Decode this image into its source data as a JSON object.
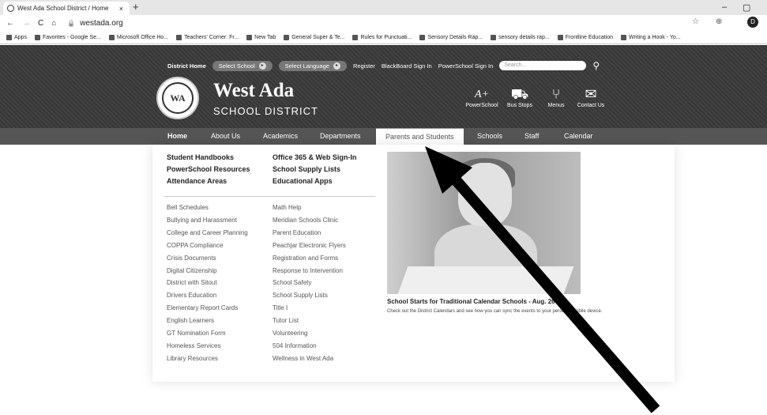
{
  "browser": {
    "tab_title": "West Ada School District / Home",
    "tab_close": "×",
    "new_tab": "+",
    "window_minimize": "–",
    "window_restore": "▢",
    "back": "←",
    "forward": "→",
    "reload": "C",
    "home": "⌂",
    "lock": "🔒",
    "url": "westada.org",
    "star_text": "☆",
    "extension_text": "⊕",
    "profile_initial": "D",
    "bookmarks": [
      "Apps",
      "Favorites - Google Se...",
      "Microsoft Office Ho...",
      "Teachers' Corner: Fr...",
      "New Tab",
      "General Super & Te...",
      "Rules for Punctuati...",
      "Sensory Details Rap...",
      "sensory details rap...",
      "Frontline Education",
      "Writing a Hook - Yo..."
    ]
  },
  "site": {
    "topnav": {
      "district_home": "District Home",
      "select_school": "Select School",
      "select_language": "Select Language",
      "register": "Register",
      "blackboard": "BlackBoard Sign In",
      "powerschool_sign_in": "PowerSchool Sign In",
      "search_placeholder": "Search..."
    },
    "logo": {
      "initials": "WA",
      "title": "West Ada",
      "subtitle": "SCHOOL DISTRICT"
    },
    "quick_links": [
      {
        "icon": "powerschool-icon",
        "glyph": "A+",
        "label": "PowerSchool"
      },
      {
        "icon": "bus-icon",
        "glyph": "🚍",
        "label": "Bus Stops"
      },
      {
        "icon": "fork-knife-icon",
        "glyph": "🍴",
        "label": "Menus"
      },
      {
        "icon": "envelope-icon",
        "glyph": "✉",
        "label": "Contact Us"
      }
    ],
    "mainnav": [
      "Home",
      "About Us",
      "Academics",
      "Departments",
      "Parents and Students",
      "Schools",
      "Staff",
      "Calendar"
    ],
    "active_nav": "Parents and Students"
  },
  "dropdown": {
    "bold_links": [
      "Student Handbooks",
      "Office 365 & Web Sign-In",
      "PowerSchool Resources",
      "School Supply Lists",
      "Attendance Areas",
      "Educational Apps"
    ],
    "left_links": [
      "Bell Schedules",
      "Bullying and Harassment",
      "College and Career Planning",
      "COPPA Compliance",
      "Crisis Documents",
      "Digital Citizenship",
      "District with Sitout",
      "Drivers Education",
      "Elementary Report Cards",
      "English Learners",
      "GT Nomination Form",
      "Homeless Services",
      "Library Resources"
    ],
    "right_links": [
      "Math Help",
      "Meridian Schools Clinic",
      "Parent Education",
      "Peachjar Electronic Flyers",
      "Registration and Forms",
      "Response to Intervention",
      "School Safety",
      "School Supply Lists",
      "Title I",
      "Tutor List",
      "Volunteering",
      "504 Information",
      "Wellness in West Ada"
    ],
    "promo": {
      "title": "School Starts for Traditional Calendar Schools - Aug. 26",
      "text": "Check out the District Calendars and see how you can sync the events to your personal mobile device."
    }
  }
}
